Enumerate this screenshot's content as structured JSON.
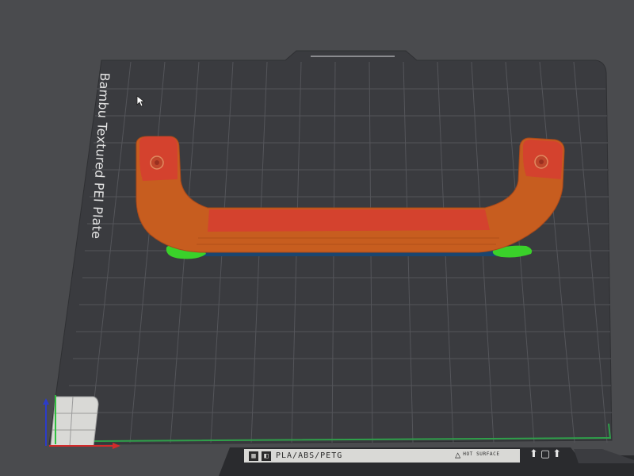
{
  "plate": {
    "name": "Bambu Textured PEI Plate",
    "filament_types": "PLA/ABS/PETG",
    "warning": "HOT SURFACE"
  },
  "colors": {
    "background": "#4a4b4e",
    "plate": "#3a3b3f",
    "grid": "#5a5b60",
    "model_wall": "#c75d1f",
    "model_top": "#d4422e",
    "support": "#3ad12a",
    "first_layer": "#1a4670",
    "axis_x": "#d32b2b",
    "axis_y": "#2fbf3f",
    "axis_z": "#2c3cc9"
  },
  "icons": {
    "strip_left": [
      "qr-code-icon",
      "bambu-logo-icon"
    ],
    "strip_warning": "hot-surface-warning-icon",
    "right": [
      "nozzle-icon",
      "plate-frame-icon",
      "trash-icon"
    ]
  }
}
